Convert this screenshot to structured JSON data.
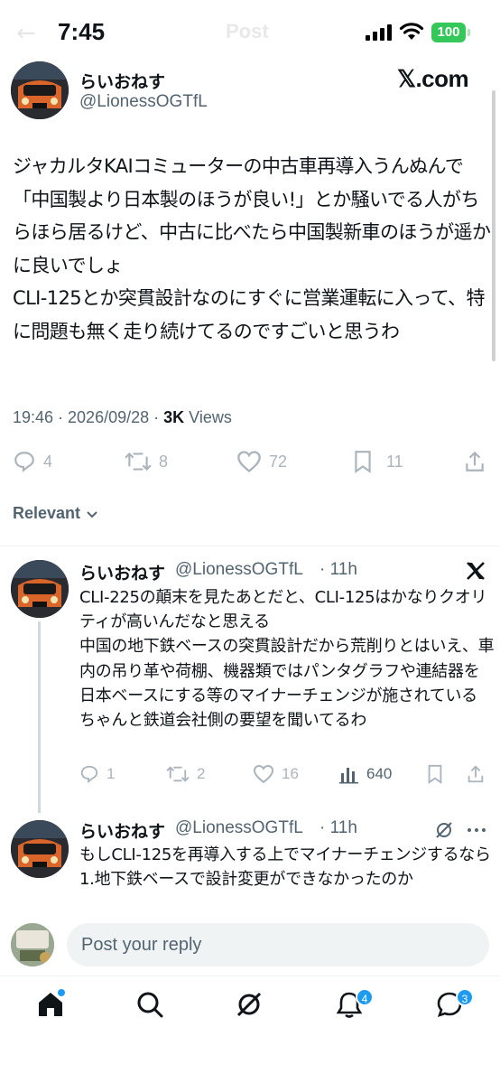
{
  "status_bar": {
    "time": "7:45",
    "ghost_title": "Post",
    "battery": "100"
  },
  "post": {
    "author_name": "らいおねす",
    "author_handle": "@LionessOGTfL",
    "brand": "𝕏.com",
    "text": "ジャカルタKAIコミューターの中古車再導入うんぬんで「中国製より日本製のほうが良い!」とか騒いでる人がちらほら居るけど、中古に比べたら中国製新車のほうが遥かに良いでしょ\nCLI-125とか突貫設計なのにすぐに営業運転に入って、特に問題も無く走り続けてるのですごいと思うわ",
    "timestamp": "19:46 · 2026/09/28 · ",
    "views_count": "3K",
    "views_label": " Views",
    "actions": {
      "replies": "4",
      "reposts": "8",
      "likes": "72",
      "bookmarks": "11"
    }
  },
  "sort": {
    "label": "Relevant"
  },
  "replies": [
    {
      "author_name": "らいおねす",
      "author_handle": "@LionessOGTfL",
      "time": "· 11h",
      "text": "CLI-225の顛末を見たあとだと、CLI-125はかなりクオリティが高いんだなと思える\n中国の地下鉄ベースの突貫設計だから荒削りとはいえ、車内の吊り革や荷棚、機器類ではパンタグラフや連結器を日本ベースにする等のマイナーチェンジが施されている\nちゃんと鉄道会社側の要望を聞いてるわ",
      "actions": {
        "replies": "1",
        "reposts": "2",
        "likes": "16",
        "views": "640"
      }
    },
    {
      "author_name": "らいおねす",
      "author_handle": "@LionessOGTfL",
      "time": "· 11h",
      "text": "もしCLI-125を再導入する上でマイナーチェンジするなら\n1.地下鉄ベースで設計変更ができなかったのか"
    }
  ],
  "composer": {
    "placeholder": "Post your reply"
  },
  "tabbar": {
    "notifications_badge": "4",
    "messages_badge": "3"
  },
  "colors": {
    "accent": "#1d9bf0",
    "battery": "#34c759",
    "muted": "#536471"
  }
}
